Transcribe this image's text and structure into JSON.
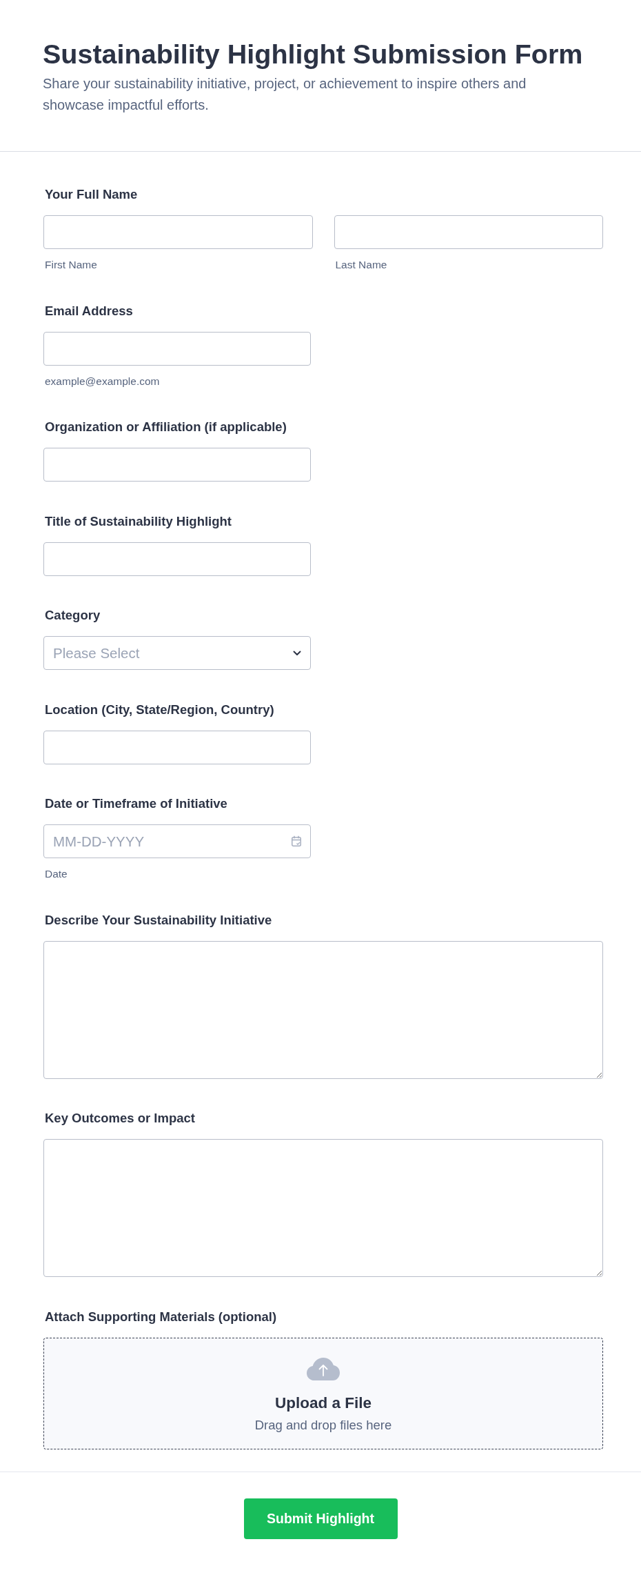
{
  "header": {
    "title": "Sustainability Highlight Submission Form",
    "description": "Share your sustainability initiative, project, or achievement to inspire others and showcase impactful efforts."
  },
  "fields": [
    {
      "kind": "name",
      "label": "Your Full Name",
      "inputs": [
        {
          "sublabel": "First Name"
        },
        {
          "sublabel": "Last Name"
        }
      ]
    },
    {
      "kind": "text",
      "label": "Email Address",
      "sublabel": "example@example.com"
    },
    {
      "kind": "text",
      "label": "Organization or Affiliation (if applicable)"
    },
    {
      "kind": "text",
      "label": "Title of Sustainability Highlight"
    },
    {
      "kind": "dropdown",
      "label": "Category",
      "placeholder": "Please Select"
    },
    {
      "kind": "text",
      "label": "Location (City, State/Region, Country)"
    },
    {
      "kind": "date",
      "label": "Date or Timeframe of Initiative",
      "placeholder": "MM-DD-YYYY",
      "sublabel": "Date"
    },
    {
      "kind": "textarea",
      "label": "Describe Your Sustainability Initiative"
    },
    {
      "kind": "textarea",
      "label": "Key Outcomes or Impact"
    },
    {
      "kind": "upload",
      "label": "Attach Supporting Materials (optional)",
      "upload_title": "Upload a File",
      "upload_hint": "Drag and drop files here"
    }
  ],
  "submit_button": {
    "label": "Submit Highlight"
  }
}
